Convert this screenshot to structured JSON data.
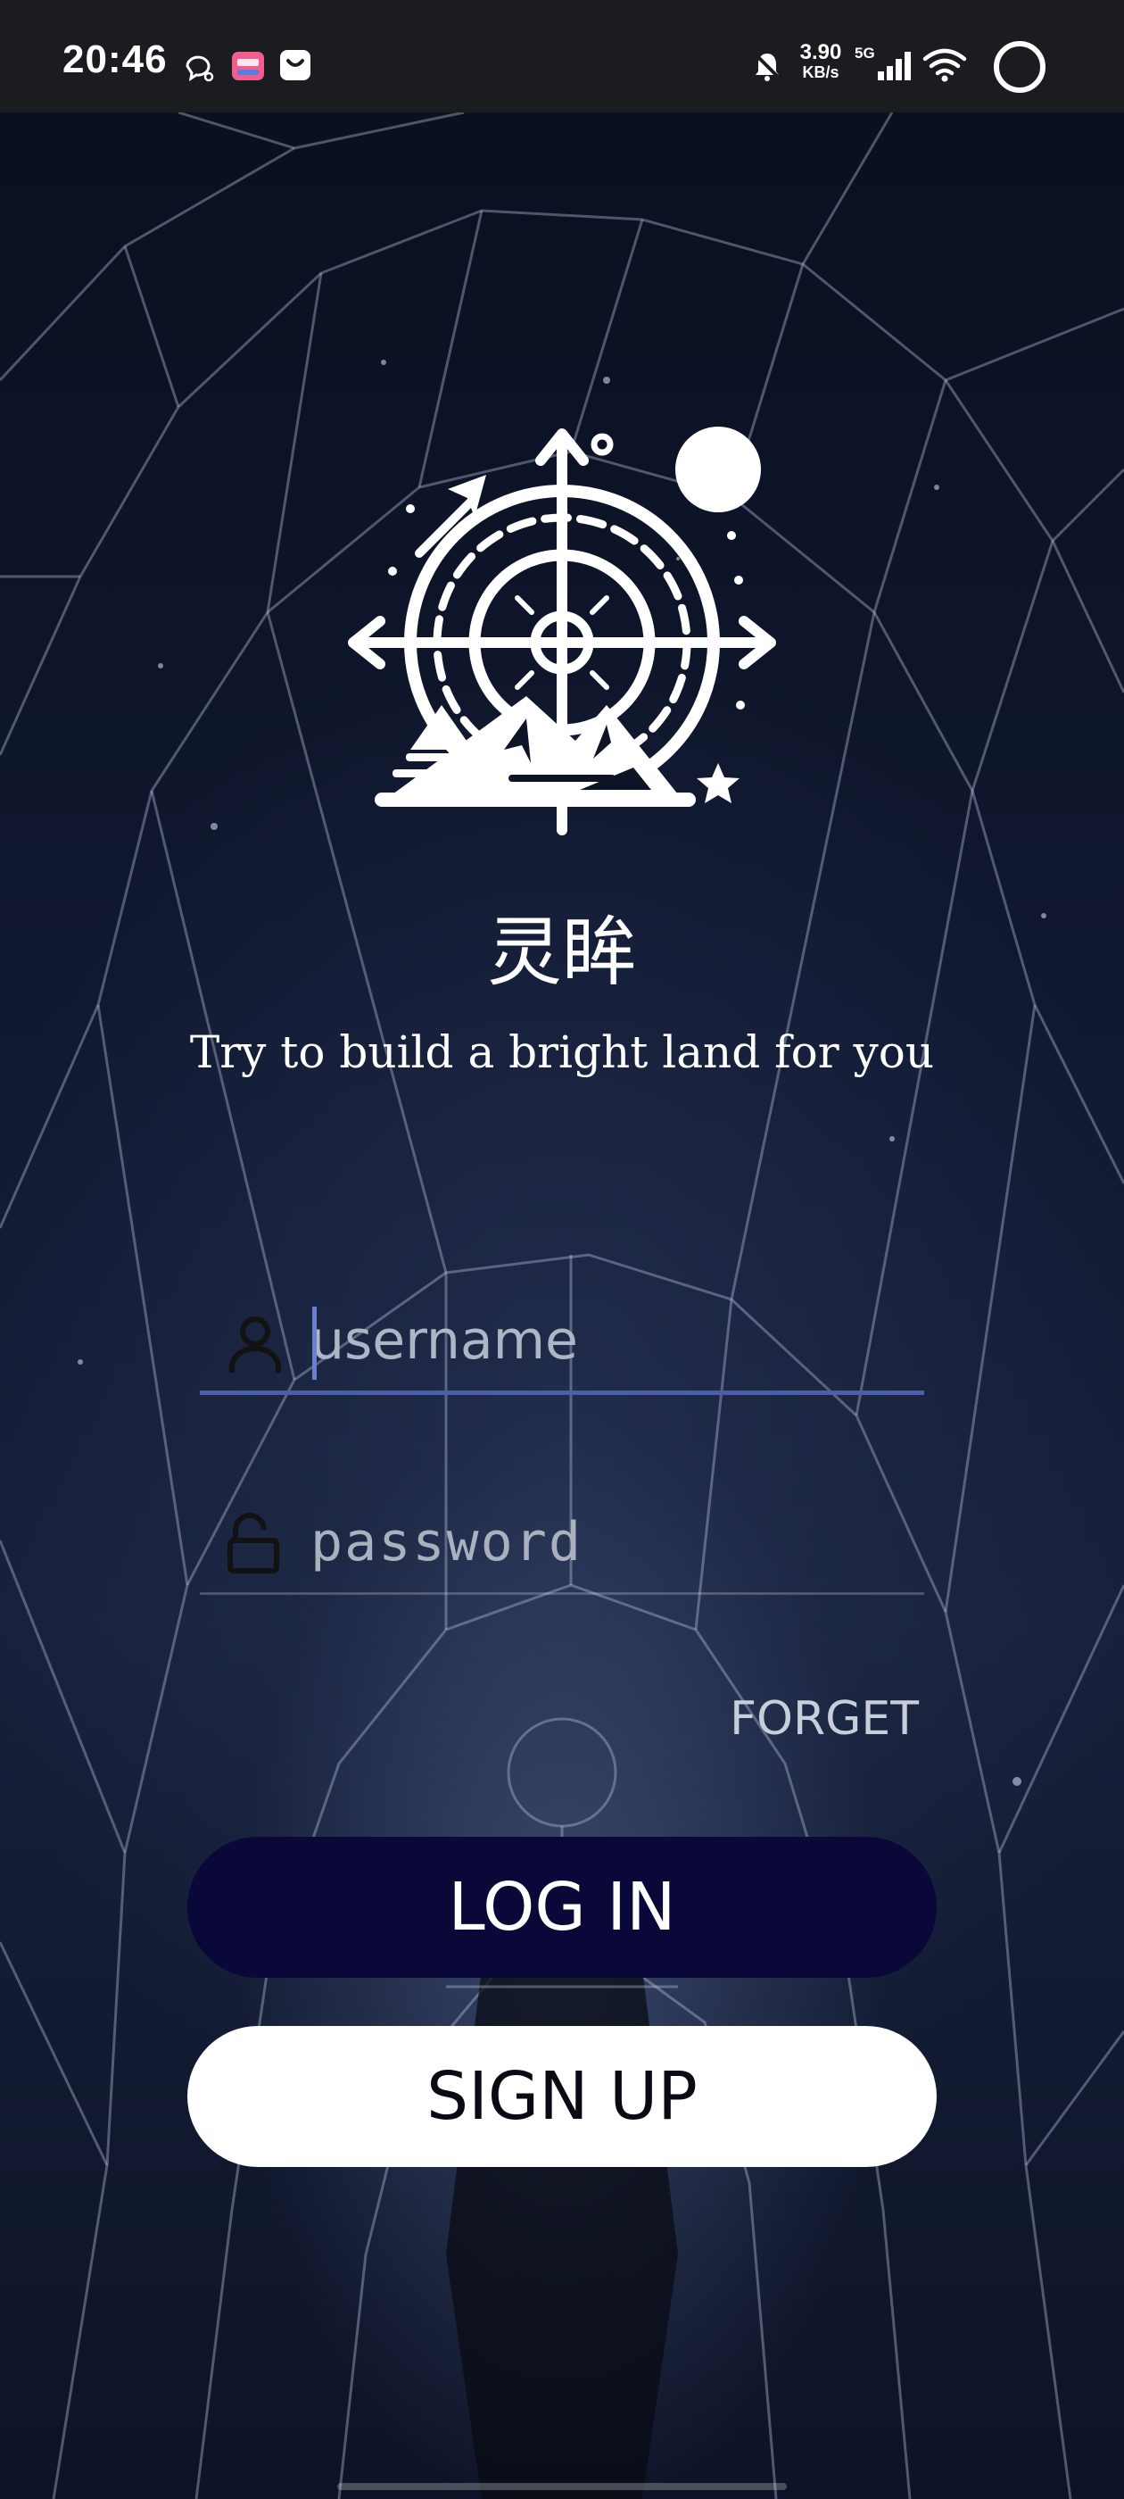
{
  "status_bar": {
    "time": "20:46",
    "net_speed_value": "3.90",
    "net_speed_unit": "KB/s",
    "network_type": "5G",
    "icons": [
      "chat-bubble-icon",
      "bilibili-icon",
      "shopping-bag-icon",
      "silent-alarm-icon",
      "signal-icon",
      "wifi-icon",
      "battery-ring-icon"
    ]
  },
  "app": {
    "name": "灵眸",
    "tagline": "Try to build a bright land for you",
    "logo_icon": "compass-mountain-logo-icon"
  },
  "form": {
    "username_placeholder": "username",
    "username_value": "",
    "username_icon": "user-icon",
    "password_placeholder": "password",
    "password_value": "",
    "password_icon": "unlock-icon",
    "forget_label": "FORGET",
    "login_label": "LOG IN",
    "signup_label": "SIGN UP"
  },
  "colors": {
    "login_button": "#0a0838",
    "signup_button": "#ffffff",
    "active_underline": "#4b5fa8",
    "status_bar": "#1b1c1f"
  }
}
